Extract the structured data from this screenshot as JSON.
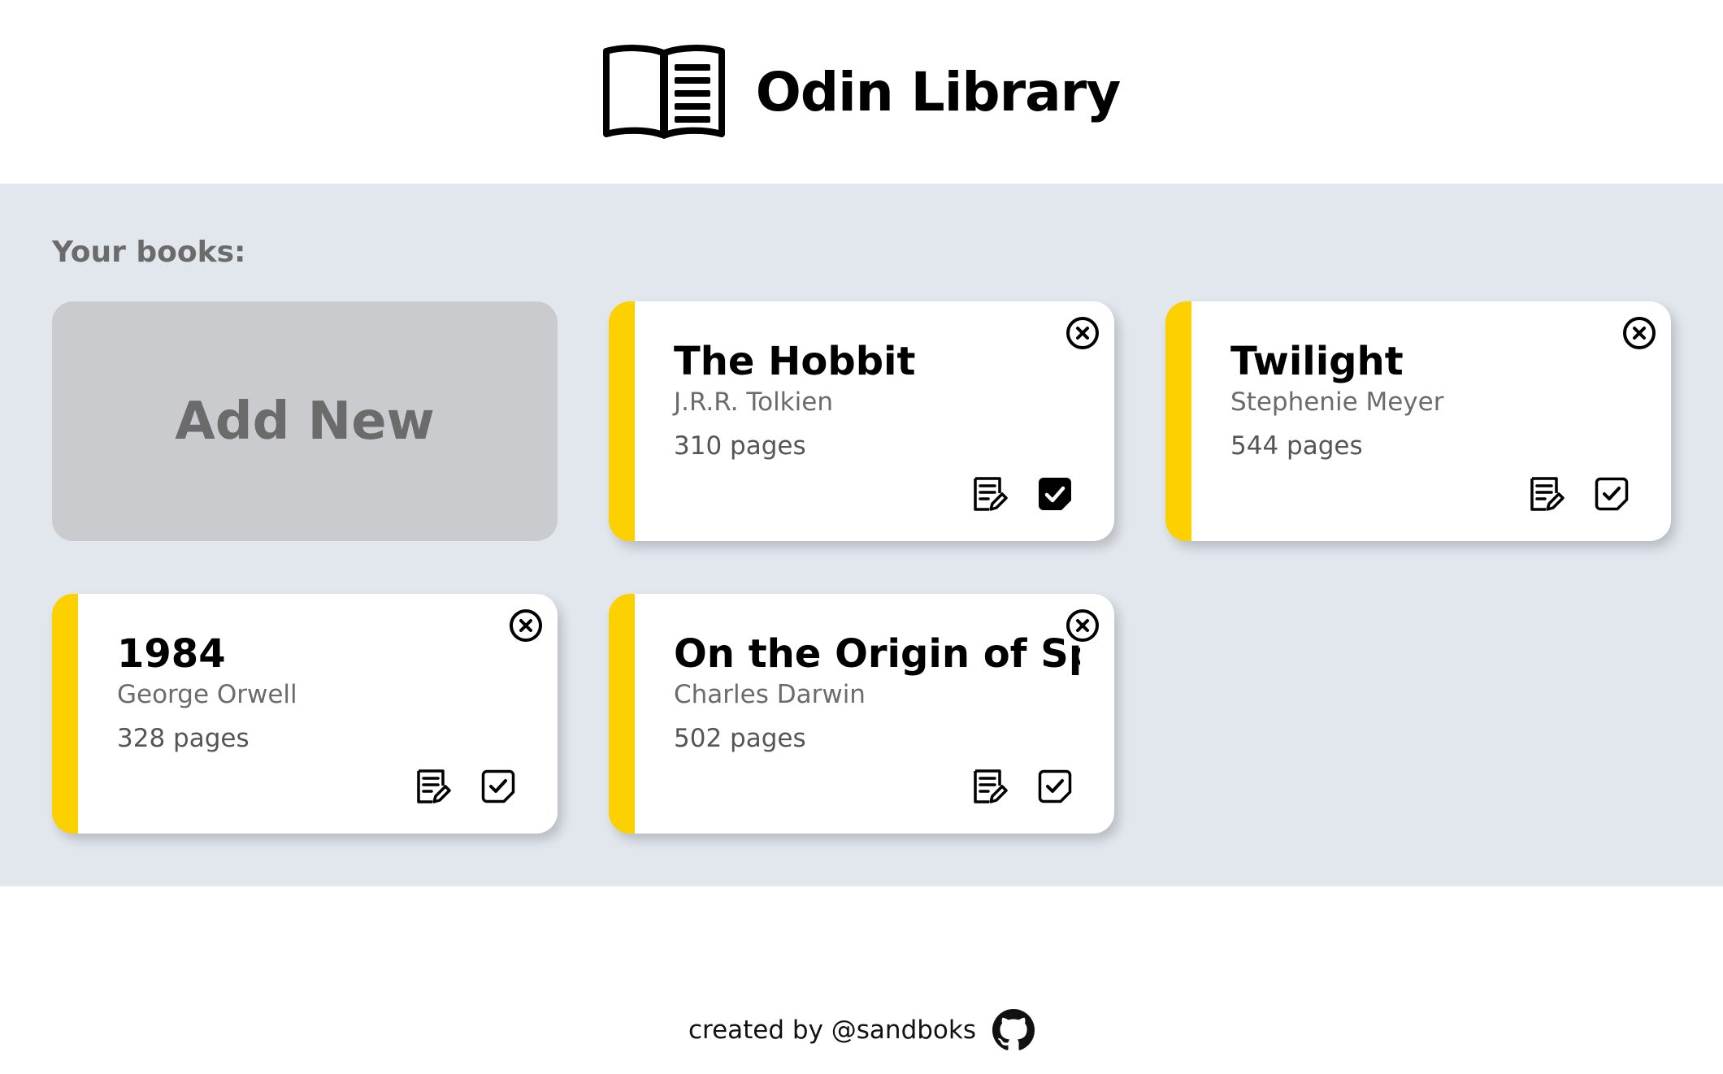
{
  "app": {
    "title": "Odin Library"
  },
  "theme": {
    "accent": "#FDD000",
    "background": "#E2E7EE",
    "add_tile": "#C9CBCF"
  },
  "main": {
    "section_label": "Your books:",
    "add_new_label": "Add New",
    "books": [
      {
        "title": "The Hobbit",
        "author": "J.R.R. Tolkien",
        "pages": "310 pages",
        "read": true
      },
      {
        "title": "Twilight",
        "author": "Stephenie Meyer",
        "pages": "544 pages",
        "read": false
      },
      {
        "title": "1984",
        "author": "George Orwell",
        "pages": "328 pages",
        "read": false
      },
      {
        "title": "On the Origin of Species",
        "author": "Charles Darwin",
        "pages": "502 pages",
        "read": false
      }
    ]
  },
  "footer": {
    "credit": "created by @sandboks"
  }
}
